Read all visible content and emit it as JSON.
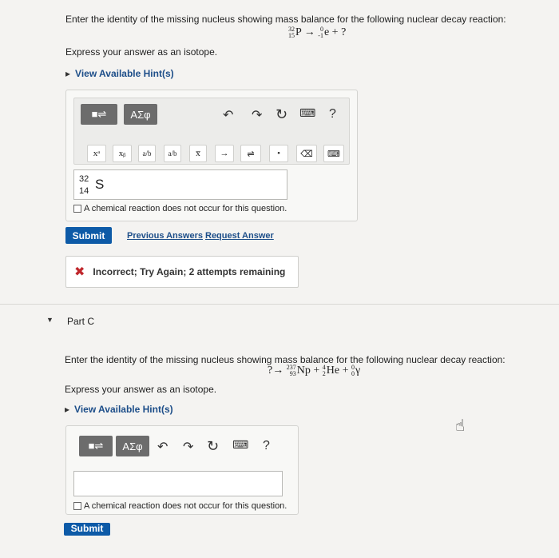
{
  "part_b": {
    "question": "Enter the identity of the missing nucleus showing mass balance for the following nuclear decay reaction:",
    "equation": {
      "reactant": {
        "mass": "32",
        "atomic": "15",
        "symbol": "P"
      },
      "arrow": "→",
      "product1": {
        "mass": "0",
        "atomic": "-1",
        "symbol": "e"
      },
      "plus": "+",
      "unknown": "?"
    },
    "express": "Express your answer as an isotope.",
    "hint": "View Available Hint(s)",
    "toolbar": {
      "template_label": "■⇌",
      "greek_label": "AΣφ",
      "undo": "↶",
      "redo": "↷",
      "reset": "↻",
      "keyboard": "⌨",
      "help": "?",
      "row2": [
        "xᵃ",
        "xᵦ",
        "a/b",
        "a/b",
        "x̅",
        "→",
        "⇌",
        "•",
        "⌫",
        "⌨"
      ]
    },
    "answer": {
      "mass": "32",
      "atomic": "14",
      "symbol": "S"
    },
    "no_reaction_label": "A chemical reaction does not occur for this question.",
    "submit": "Submit",
    "previous_answers": "Previous Answers",
    "request_answer": "Request Answer",
    "feedback": "Incorrect; Try Again; 2 attempts remaining"
  },
  "part_c": {
    "title": "Part C",
    "question": "Enter the identity of the missing nucleus showing mass balance for the following nuclear decay reaction:",
    "equation": {
      "unknown": "?",
      "arrow": "→",
      "product1": {
        "mass": "237",
        "atomic": "93",
        "symbol": "Np"
      },
      "plus1": "+",
      "product2": {
        "mass": "4",
        "atomic": "2",
        "symbol": "He"
      },
      "plus2": "+",
      "product3": {
        "mass": "0",
        "atomic": "0",
        "symbol": "γ"
      }
    },
    "express": "Express your answer as an isotope.",
    "hint": "View Available Hint(s)",
    "toolbar": {
      "template_label": "■⇌",
      "greek_label": "AΣφ",
      "undo": "↶",
      "redo": "↷",
      "reset": "↻",
      "keyboard": "⌨",
      "help": "?"
    },
    "no_reaction_label": "A chemical reaction does not occur for this question.",
    "submit": "Submit"
  }
}
